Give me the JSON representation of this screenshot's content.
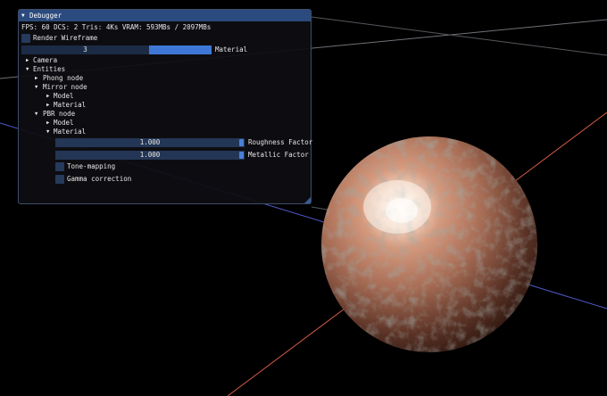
{
  "debugger": {
    "title": "Debugger",
    "stats": "FPS: 60 DCS: 2 Tris: 4Ks  VRAM: 593MBs / 2097MBs",
    "render_wireframe_label": "Render Wireframe",
    "render_wireframe_checked": false,
    "material_slider": {
      "value": "3",
      "label": "Material"
    },
    "tree": {
      "camera": "Camera",
      "entities": "Entities",
      "phong_node": "Phong node",
      "mirror_node": "Mirror node",
      "mirror_model": "Model",
      "mirror_material": "Material",
      "pbr_node": "PBR node",
      "pbr_model": "Model",
      "pbr_material": "Material"
    },
    "roughness": {
      "value": "1.000",
      "label": "Roughness Factor"
    },
    "metallic": {
      "value": "1.000",
      "label": "Metallic Factor"
    },
    "tone_mapping": {
      "label": "Tone-mapping",
      "checked": false
    },
    "gamma_correction": {
      "label": "Gamma correction",
      "checked": false
    }
  },
  "colors": {
    "title_bar": "#2b4a7e",
    "accent": "#4b7fd6",
    "frame_bg": "#263a5c",
    "axis_red": "#d85a45",
    "axis_blue": "#4d5ac8",
    "axis_gray": "#6f7278",
    "sphere_highlight": "#fff4ea",
    "sphere_base": "#a86d55"
  },
  "icons": {
    "collapse": "triangle-down-icon",
    "tree_collapsed": "triangle-right-icon",
    "tree_expanded": "triangle-down-icon"
  }
}
